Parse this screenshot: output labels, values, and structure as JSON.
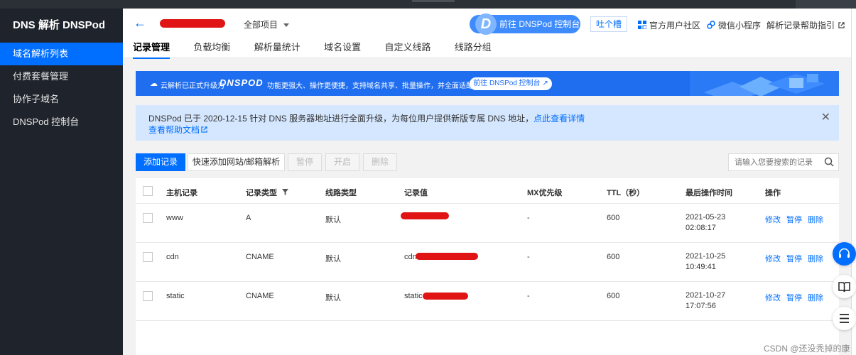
{
  "sidebar": {
    "brand": "DNS 解析 DNSPod",
    "items": [
      {
        "label": "域名解析列表",
        "active": true
      },
      {
        "label": "付费套餐管理",
        "active": false
      },
      {
        "label": "协作子域名",
        "active": false
      },
      {
        "label": "DNSPod 控制台",
        "active": false
      }
    ]
  },
  "header": {
    "back_icon": "arrow-left-icon",
    "project": "全部项目",
    "console_button": "前往 DNSPod 控制台",
    "console_logo": "D",
    "feedback": "吐个槽",
    "links": [
      "官方用户社区",
      "微信小程序",
      "解析记录帮助指引"
    ],
    "tabs": [
      "记录管理",
      "负载均衡",
      "解析量统计",
      "域名设置",
      "自定义线路",
      "线路分组"
    ],
    "active_tab": 0
  },
  "banner": {
    "text1": "云解析已正式升级为",
    "logo": "DNSPOD",
    "text2": "功能更强大、操作更便捷，支持域名共享、批量操作，并全面适配手机端",
    "button": "前往 DNSPod 控制台"
  },
  "notice": {
    "line1": "DNSPod 已于 2020-12-15 针对 DNS 服务器地址进行全面升级，为每位用户提供新版专属 DNS 地址，",
    "line1_link": "点此查看详情",
    "line2": "查看帮助文档"
  },
  "toolbar": {
    "add": "添加记录",
    "quick_add": "快速添加网站/邮箱解析",
    "pause": "暂停",
    "enable": "开启",
    "delete": "删除",
    "search_placeholder": "请输入您要搜索的记录"
  },
  "table": {
    "headers": [
      "主机记录",
      "记录类型",
      "线路类型",
      "记录值",
      "MX优先级",
      "TTL（秒）",
      "最后操作时间",
      "操作"
    ],
    "rows": [
      {
        "host": "www",
        "type": "A",
        "line": "默认",
        "value": "",
        "mx": "-",
        "ttl": "600",
        "date": "2021-05-23",
        "time": "02:08:17"
      },
      {
        "host": "cdn",
        "type": "CNAME",
        "line": "默认",
        "value": "cdn-idvhh7a...",
        "mx": "-",
        "ttl": "600",
        "date": "2021-10-25",
        "time": "10:49:41"
      },
      {
        "host": "static",
        "type": "CNAME",
        "line": "默认",
        "value": "static-idvhia...",
        "mx": "-",
        "ttl": "600",
        "date": "2021-10-27",
        "time": "17:07:56"
      }
    ],
    "ops": [
      "修改",
      "暂停",
      "删除"
    ]
  },
  "watermark": "CSDN @还没秃掉的康",
  "colors": {
    "primary": "#006eff",
    "sidebar": "#1f232b",
    "redaction": "#e01414"
  }
}
